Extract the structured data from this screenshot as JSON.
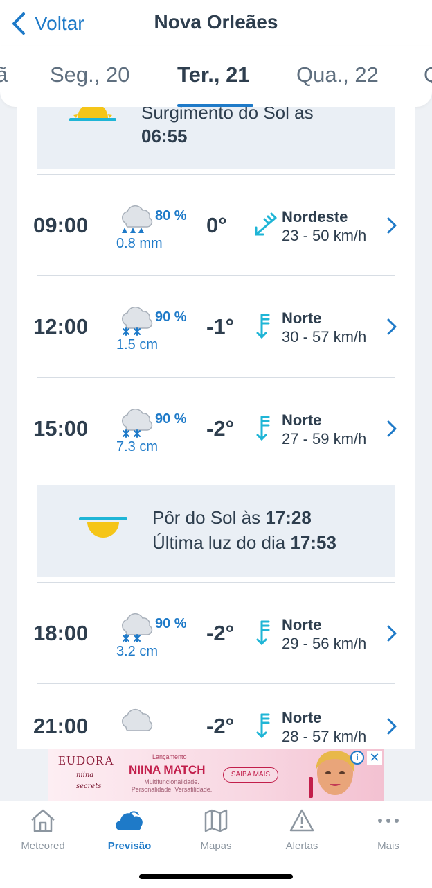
{
  "header": {
    "back_label": "Voltar",
    "title": "Nova Orleães"
  },
  "tabs": [
    {
      "label": "ã",
      "active": false
    },
    {
      "label": "Seg., 20",
      "active": false
    },
    {
      "label": "Ter., 21",
      "active": true
    },
    {
      "label": "Qua., 22",
      "active": false
    },
    {
      "label": "Q",
      "active": false
    }
  ],
  "sunrise": {
    "label": "Surgimento do Sol as",
    "time": "06:55"
  },
  "sunset": {
    "line1_label": "Pôr do Sol às",
    "line1_time": "17:28",
    "line2_label": "Última luz do dia",
    "line2_time": "17:53"
  },
  "forecast": [
    {
      "time": "09:00",
      "icon": "cloud-rain-icon",
      "probability": "80 %",
      "precip": "0.8 mm",
      "temp": "0°",
      "wind_dir": "Nordeste",
      "wind_speed": "23 - 50 km/h",
      "wind_icon": "wind-northeast-icon"
    },
    {
      "time": "12:00",
      "icon": "cloud-snow-icon",
      "probability": "90 %",
      "precip": "1.5 cm",
      "temp": "-1°",
      "wind_dir": "Norte",
      "wind_speed": "30 - 57 km/h",
      "wind_icon": "wind-north-icon"
    },
    {
      "time": "15:00",
      "icon": "cloud-snow-icon",
      "probability": "90 %",
      "precip": "7.3 cm",
      "temp": "-2°",
      "wind_dir": "Norte",
      "wind_speed": "27 - 59 km/h",
      "wind_icon": "wind-north-icon"
    },
    {
      "time": "18:00",
      "icon": "cloud-snow-icon",
      "probability": "90 %",
      "precip": "3.2 cm",
      "temp": "-2°",
      "wind_dir": "Norte",
      "wind_speed": "29 - 56 km/h",
      "wind_icon": "wind-north-icon"
    },
    {
      "time": "21:00",
      "icon": "cloud-icon",
      "probability": "",
      "precip": "",
      "temp": "-2°",
      "wind_dir": "Norte",
      "wind_speed": "28 - 57 km/h",
      "wind_icon": "wind-north-icon"
    }
  ],
  "ad": {
    "brand": "EUDORA",
    "sub1": "niina",
    "sub2": "secrets",
    "pre": "Lançamento",
    "title": "NIINA MATCH",
    "desc": "Multifuncionalidade. Personalidade. Versatilidade.",
    "cta": "SAIBA MAIS",
    "info": "i",
    "close": "✕"
  },
  "bottom_nav": [
    {
      "label": "Meteored",
      "icon": "home-icon",
      "active": false
    },
    {
      "label": "Previsão",
      "icon": "cloud-icon",
      "active": true
    },
    {
      "label": "Mapas",
      "icon": "map-icon",
      "active": false
    },
    {
      "label": "Alertas",
      "icon": "alert-icon",
      "active": false
    },
    {
      "label": "Mais",
      "icon": "more-icon",
      "active": false
    }
  ],
  "colors": {
    "accent": "#1e7ac8",
    "text": "#2e3e4e",
    "panel": "#eaeff5",
    "sun": "#f5c518",
    "wind_icon": "#1fb5d6"
  }
}
